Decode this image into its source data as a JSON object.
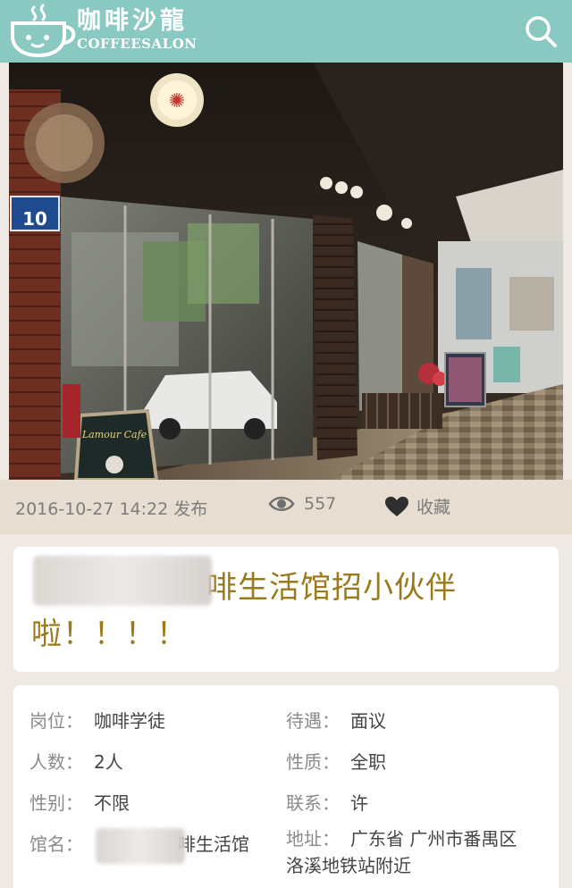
{
  "header": {
    "brand_cn": "咖啡沙龍",
    "brand_en": "COFFEESALON",
    "bg_color": "#8ac9c1",
    "search_icon": "search-icon",
    "logo_icon": "coffee-cup-logo"
  },
  "hero": {
    "street_sign_number": "10",
    "board_text": "Lamour Cafe"
  },
  "meta": {
    "date": "2016-10-27 14:22 发布",
    "views": "557",
    "favorite_label": "收藏",
    "view_icon": "eye-icon",
    "favorite_icon": "heart-icon"
  },
  "post": {
    "title_line1": "啡生活馆招小伙伴",
    "title_line2": "啦！！！！"
  },
  "details": [
    {
      "label": "岗位：",
      "value": "咖啡学徒"
    },
    {
      "label": "待遇：",
      "value": "面议"
    },
    {
      "label": "人数：",
      "value": "2人"
    },
    {
      "label": "性质：",
      "value": "全职"
    },
    {
      "label": "性别：",
      "value": "不限"
    },
    {
      "label": "联系：",
      "value": "许"
    },
    {
      "label": "馆名：",
      "value": "啡生活馆"
    },
    {
      "label": "地址：",
      "value": "广东省 广州市番禺区",
      "value2": "洛溪地铁站附近"
    }
  ]
}
